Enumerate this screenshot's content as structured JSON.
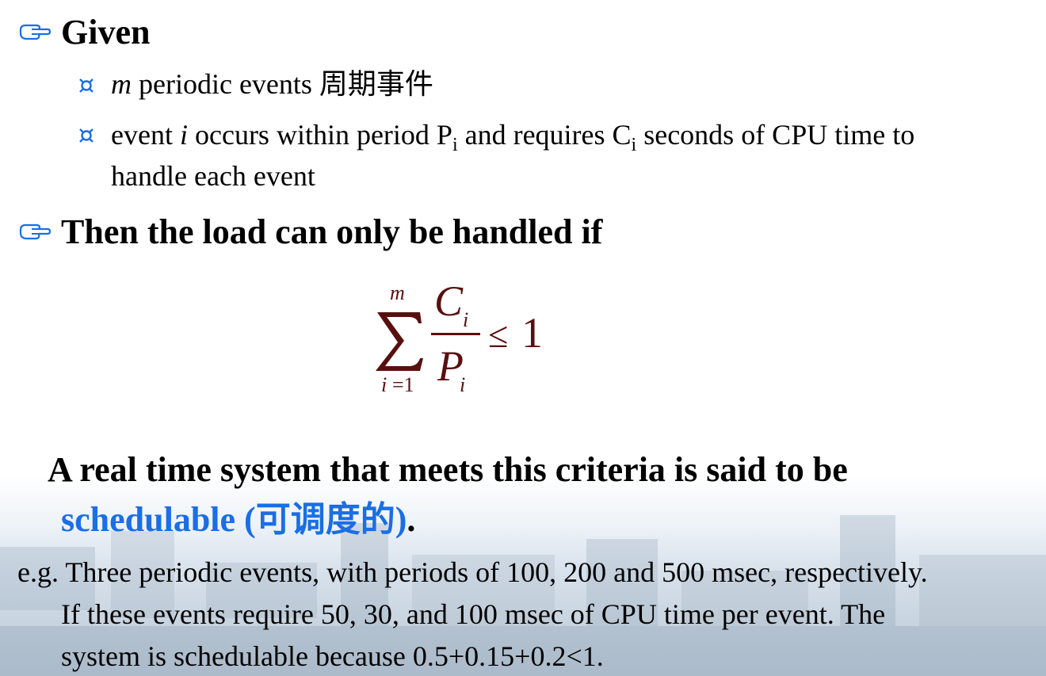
{
  "section_given": {
    "heading": "Given",
    "items": [
      {
        "italic": "m",
        "text": " periodic events 周期事件"
      },
      {
        "line1_prefix": "event ",
        "line1_italic": "i",
        "line1_mid": " occurs within period P",
        "line1_sub1": "i",
        "line1_mid2": " and requires C",
        "line1_sub2": "i",
        "line1_suffix": " seconds of CPU time to",
        "line2": "handle each event"
      }
    ]
  },
  "section_then": {
    "heading": "Then the load can only be handled if"
  },
  "formula": {
    "sum_upper": "m",
    "sum_lower_var": "i",
    "sum_lower_eq": "=1",
    "numerator": "C",
    "numerator_sub": "i",
    "denominator": "P",
    "denominator_sub": "i",
    "relation": "≤",
    "rhs": "1",
    "color": "#5a0f0f"
  },
  "criteria": {
    "line1": "A real time system that meets this criteria is said to be",
    "term": "schedulable (可调度的)",
    "term_end": ".",
    "term_color": "#1a6ee6"
  },
  "example": {
    "line1": "e.g. Three periodic events, with periods of 100, 200 and 500 msec, respectively.",
    "line2": "If these events require 50, 30, and 100 msec of CPU time per event. The",
    "line3": "system is schedulable because 0.5+0.15+0.2<1."
  },
  "icons": {
    "level1": "pointing-hand-icon",
    "level2": "currency-sign-bullet-icon",
    "accent": "#1a6ee6"
  }
}
